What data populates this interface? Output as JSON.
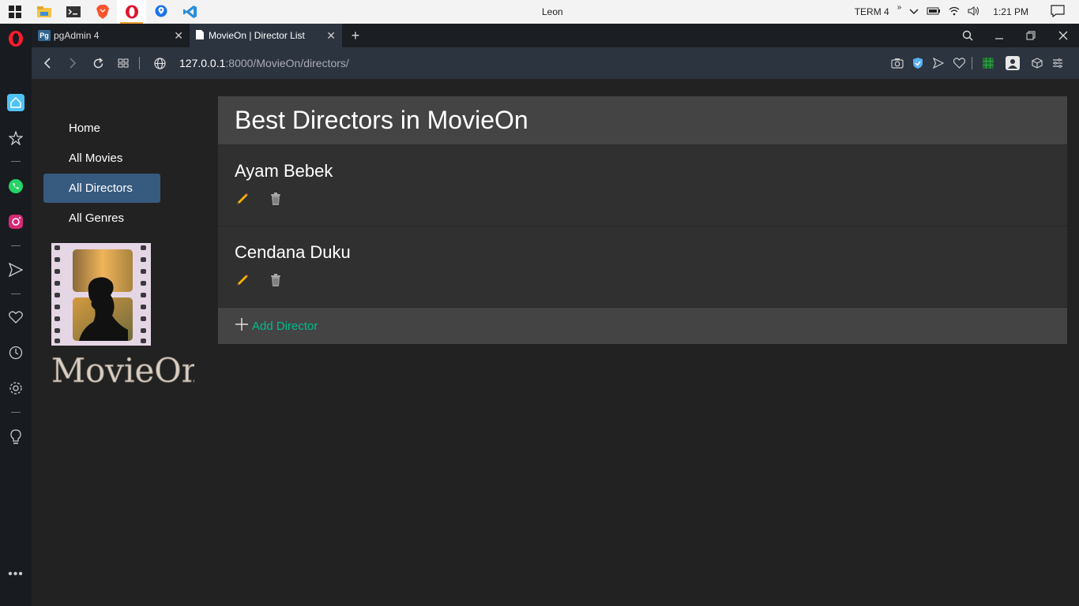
{
  "taskbar": {
    "window_title": "Leon",
    "network_label": "TERM 4",
    "clock": "1:21 PM",
    "apps": [
      "windows-start-icon",
      "file-explorer-icon",
      "terminal-icon",
      "brave-icon",
      "opera-icon",
      "maps-icon",
      "vscode-icon"
    ]
  },
  "browser": {
    "tabs": [
      {
        "title": "pgAdmin 4",
        "icon": "pgadmin-icon"
      },
      {
        "title": "MovieOn | Director List",
        "icon": "page-icon"
      }
    ],
    "url_host": "127.0.0.1",
    "url_path": ":8000/MovieOn/directors/"
  },
  "nav": {
    "items": [
      {
        "label": "Home"
      },
      {
        "label": "All Movies"
      },
      {
        "label": "All Directors"
      },
      {
        "label": "All Genres"
      }
    ]
  },
  "logo": {
    "text": "MovieOn"
  },
  "main": {
    "title": "Best Directors in MovieOn",
    "directors": [
      {
        "name": "Ayam Bebek"
      },
      {
        "name": "Cendana Duku"
      }
    ],
    "add_label": "Add Director"
  },
  "colors": {
    "active_nav": "#375a7f",
    "accent_green": "#00bc8c",
    "heading_bg": "#444444",
    "card_bg": "#303030"
  }
}
